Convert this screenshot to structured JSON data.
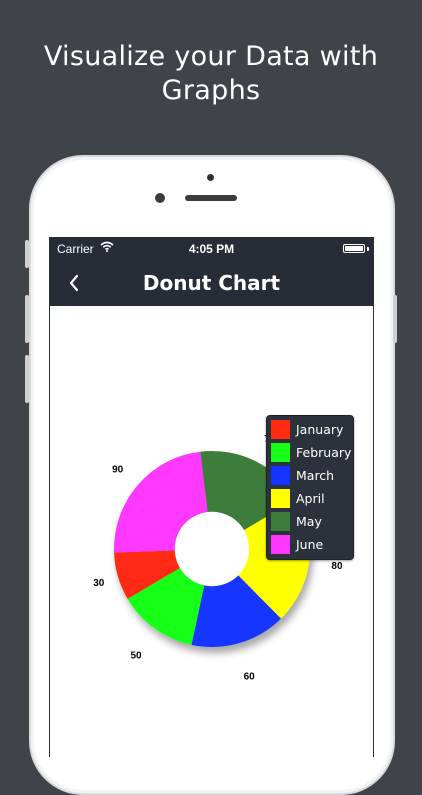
{
  "headline": {
    "line1": "Visualize your Data with",
    "line2": "Graphs"
  },
  "status_bar": {
    "carrier": "Carrier",
    "time": "4:05 PM"
  },
  "nav": {
    "title": "Donut Chart"
  },
  "chart_data": {
    "type": "pie",
    "subtype": "donut",
    "categories": [
      "January",
      "February",
      "March",
      "April",
      "May",
      "June"
    ],
    "values": [
      30,
      50,
      60,
      80,
      70,
      90
    ],
    "colors": [
      "#ff2a12",
      "#17ff17",
      "#1634ff",
      "#ffff00",
      "#3d7c3a",
      "#ff38ff"
    ],
    "data_labels": [
      "30",
      "50",
      "60",
      "80",
      "7",
      "90"
    ],
    "legend_position": "top-right",
    "hole_ratio": 0.38
  }
}
